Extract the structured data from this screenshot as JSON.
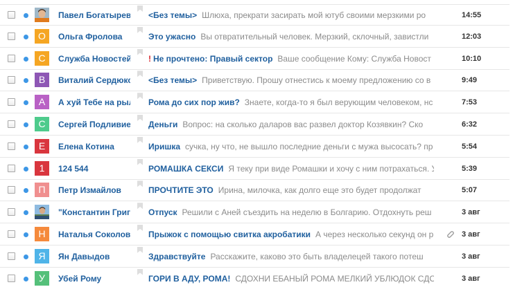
{
  "messages": [
    {
      "sender": "Павел Богатырев",
      "avatar": {
        "kind": "photo",
        "photo": "man-orange-shirt"
      },
      "important": false,
      "subject": "<Без темы>",
      "snippet": "Шлюха, прекрати засирать мой ютуб своими мерзкими ро",
      "time": "14:55",
      "attachment": false
    },
    {
      "sender": "Ольга Фролова",
      "avatar": {
        "kind": "letter",
        "letter": "О",
        "color": "#f5a623"
      },
      "important": false,
      "subject": "Это ужасно",
      "snippet": "Вы отвратительный человек. Мерзкий, склочный, завистли",
      "time": "12:03",
      "attachment": false
    },
    {
      "sender": "Служба Новостей",
      "avatar": {
        "kind": "letter",
        "letter": "С",
        "color": "#f5a623"
      },
      "important": true,
      "subject": "Не прочтено: Правый сектор",
      "snippet": "Ваше сообщение Кому: Служба Новост",
      "time": "10:10",
      "attachment": false
    },
    {
      "sender": "Виталий Сердюкс",
      "avatar": {
        "kind": "letter",
        "letter": "В",
        "color": "#8e57b5"
      },
      "important": false,
      "subject": "<Без темы>",
      "snippet": "Приветствую. Прошу отнестись к моему предложению со в",
      "time": "9:49",
      "attachment": false
    },
    {
      "sender": "А хуй Тебе на рыл",
      "avatar": {
        "kind": "letter",
        "letter": "А",
        "color": "#b961c5"
      },
      "important": false,
      "subject": "Рома до сих пор жив?",
      "snippet": "Знаете, когда-то я был верующим человеком, нс",
      "time": "7:53",
      "attachment": false
    },
    {
      "sender": "Сергей Подливие",
      "avatar": {
        "kind": "letter",
        "letter": "С",
        "color": "#4ecb8c"
      },
      "important": false,
      "subject": "Деньги",
      "snippet": "Вопрос: на сколько даларов вас развел доктор Козявкин? Ско",
      "time": "6:32",
      "attachment": false
    },
    {
      "sender": "Елена Котина",
      "avatar": {
        "kind": "letter",
        "letter": "Е",
        "color": "#d9363e"
      },
      "important": false,
      "subject": "Иришка",
      "snippet": "сучка, ну что, не вышло последние деньги с мужа высосать? пр",
      "time": "5:54",
      "attachment": false
    },
    {
      "sender": "124 544",
      "avatar": {
        "kind": "letter",
        "letter": "1",
        "color": "#d9363e"
      },
      "important": false,
      "subject": "РОМАШКА СЕКСИ",
      "snippet": "Я теку при виде Ромашки и хочу с ним потрахаться. У",
      "time": "5:39",
      "attachment": false
    },
    {
      "sender": "Петр Измайлов",
      "avatar": {
        "kind": "letter",
        "letter": "П",
        "color": "#f08f8f"
      },
      "important": false,
      "subject": "ПРОЧТИТЕ ЭТО",
      "snippet": "Ирина, милочка, как долго еще это будет продолжат",
      "time": "5:07",
      "attachment": false
    },
    {
      "sender": "\"Константин Григ",
      "avatar": {
        "kind": "photo",
        "photo": "man-outdoors"
      },
      "important": false,
      "subject": "Отпуск",
      "snippet": "Решили с Аней съездить на неделю в Болгарию. Отдохнуть реш",
      "time": "3 авг",
      "attachment": false
    },
    {
      "sender": "Наталья Соколов",
      "avatar": {
        "kind": "letter",
        "letter": "Н",
        "color": "#f58a3c"
      },
      "important": false,
      "subject": "Прыжок с помощью свитка акробатики",
      "snippet": "А через несколько секунд он р",
      "time": "3 авг",
      "attachment": true
    },
    {
      "sender": "Ян Давыдов",
      "avatar": {
        "kind": "letter",
        "letter": "Я",
        "color": "#4fb4e8"
      },
      "important": false,
      "subject": "Здравствуйте",
      "snippet": "Расскажите, каково это быть владелецей такого потеш",
      "time": "3 авг",
      "attachment": false
    },
    {
      "sender": "Убей Рому",
      "avatar": {
        "kind": "letter",
        "letter": "У",
        "color": "#55c07a"
      },
      "important": false,
      "subject": "ГОРИ В АДУ, РОМА!",
      "snippet": "СДОХНИ ЕБАНЫЙ РОМА МЕЛКИЙ УБЛЮДОК СДО:",
      "time": "3 авг",
      "attachment": false
    }
  ],
  "icons": {
    "unread": "unread-dot-icon",
    "flag": "flag-icon",
    "important": "!",
    "attachment": "paperclip-icon"
  },
  "colors": {
    "accent": "#1f5f9e",
    "unread_dot": "#3d97e6",
    "important": "#d7282f",
    "snippet": "#8b8b8b"
  }
}
